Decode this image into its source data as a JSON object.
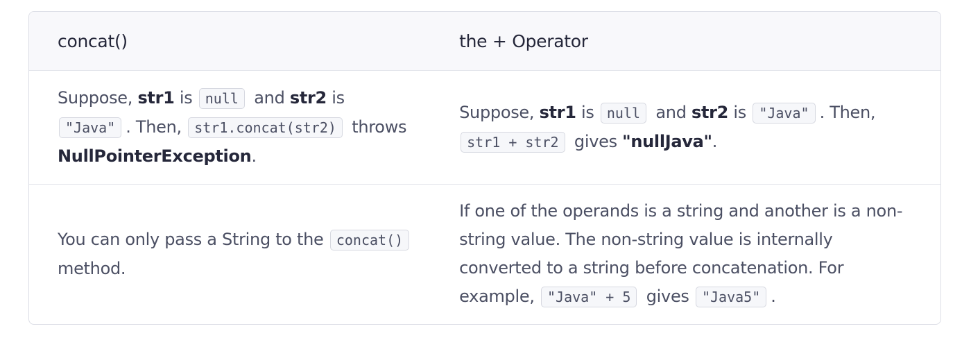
{
  "table": {
    "header": {
      "col1": "concat()",
      "col2": "the + Operator"
    },
    "row1": {
      "col1": {
        "t1": "Suppose, ",
        "b1": "str1",
        "t2": " is ",
        "c1": "null",
        "t3": " and ",
        "b2": "str2",
        "t4": " is ",
        "c2": "\"Java\"",
        "t5": ". Then, ",
        "c3": "str1.concat(str2)",
        "t6": " throws ",
        "b3": "NullPointerException",
        "t7": "."
      },
      "col2": {
        "t1": "Suppose, ",
        "b1": "str1",
        "t2": " is ",
        "c1": "null",
        "t3": " and ",
        "b2": "str2",
        "t4": " is ",
        "c2": "\"Java\"",
        "t5": ". Then, ",
        "c3": "str1 + str2",
        "t6": " gives ",
        "b3": "\"nullJava\"",
        "t7": "."
      }
    },
    "row2": {
      "col1": {
        "t1": "You can only pass a String to the ",
        "c1": "concat()",
        "t2": " method."
      },
      "col2": {
        "t1": "If one of the operands is a string and another is a non-string value. The non-string value is internally converted to a string before concatenation. For example, ",
        "c1": "\"Java\" + 5",
        "t2": " gives ",
        "c2": "\"Java5\"",
        "t3": "."
      }
    }
  }
}
